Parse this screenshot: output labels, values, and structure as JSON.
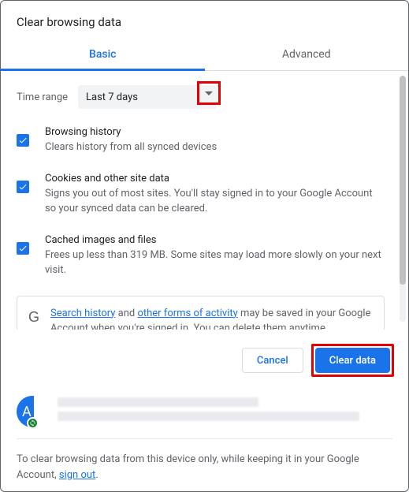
{
  "title": "Clear browsing data",
  "tabs": {
    "basic": "Basic",
    "advanced": "Advanced"
  },
  "timerange": {
    "label": "Time range",
    "value": "Last 7 days"
  },
  "options": [
    {
      "title": "Browsing history",
      "desc": "Clears history from all synced devices"
    },
    {
      "title": "Cookies and other site data",
      "desc": "Signs you out of most sites. You'll stay signed in to your Google Account so your synced data can be cleared."
    },
    {
      "title": "Cached images and files",
      "desc": "Frees up less than 319 MB. Some sites may load more slowly on your next visit."
    }
  ],
  "info": {
    "link1": "Search history",
    "mid1": " and ",
    "link2": "other forms of activity",
    "rest": " may be saved in your Google Account when you're signed in. You can delete them anytime."
  },
  "buttons": {
    "cancel": "Cancel",
    "clear": "Clear data"
  },
  "avatar_letter": "A",
  "footer": {
    "text": "To clear browsing data from this device only, while keeping it in your Google Account, ",
    "link": "sign out",
    "after": "."
  }
}
